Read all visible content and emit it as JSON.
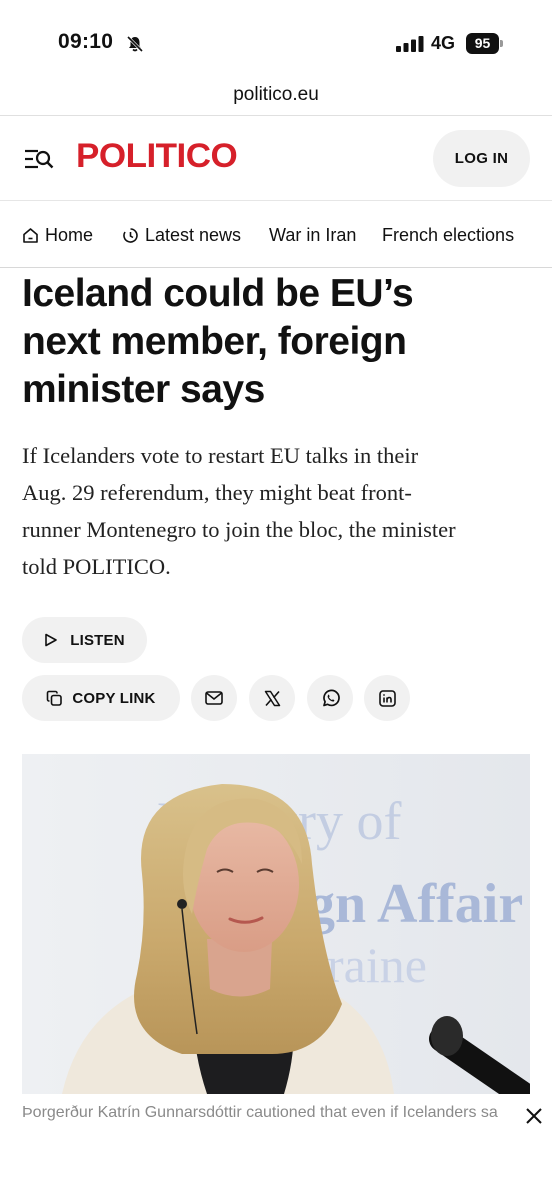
{
  "status_bar": {
    "time": "09:10",
    "network": "4G",
    "battery": "95"
  },
  "browser": {
    "url": "politico.eu"
  },
  "header": {
    "logo": "POLITICO",
    "login_label": "LOG IN",
    "brand_color": "#d6202a"
  },
  "nav": {
    "items": [
      {
        "label": "Home",
        "icon": "home-icon"
      },
      {
        "label": "Latest news",
        "icon": "clock-icon"
      },
      {
        "label": "War in Iran"
      },
      {
        "label": "French elections"
      }
    ]
  },
  "article": {
    "headline_lines": [
      "Iceland could be EU’s",
      "next member, foreign",
      "minister says"
    ],
    "dek_lines": [
      "If Icelanders vote to restart EU talks in their",
      "Aug. 29 referendum, they might beat front-",
      "runner Montenegro to join the bloc, the minister",
      "told POLITICO."
    ],
    "listen_label": "LISTEN",
    "copy_link_label": "COPY LINK",
    "share_icons": [
      "email-icon",
      "x-icon",
      "whatsapp-icon",
      "linkedin-icon"
    ],
    "photo_backdrop_lines": [
      "Ministry of",
      "gn Affair",
      "raine"
    ],
    "caption": "Þorgerður Katrín Gunnarsdóttir cautioned that even if Icelanders sa"
  }
}
